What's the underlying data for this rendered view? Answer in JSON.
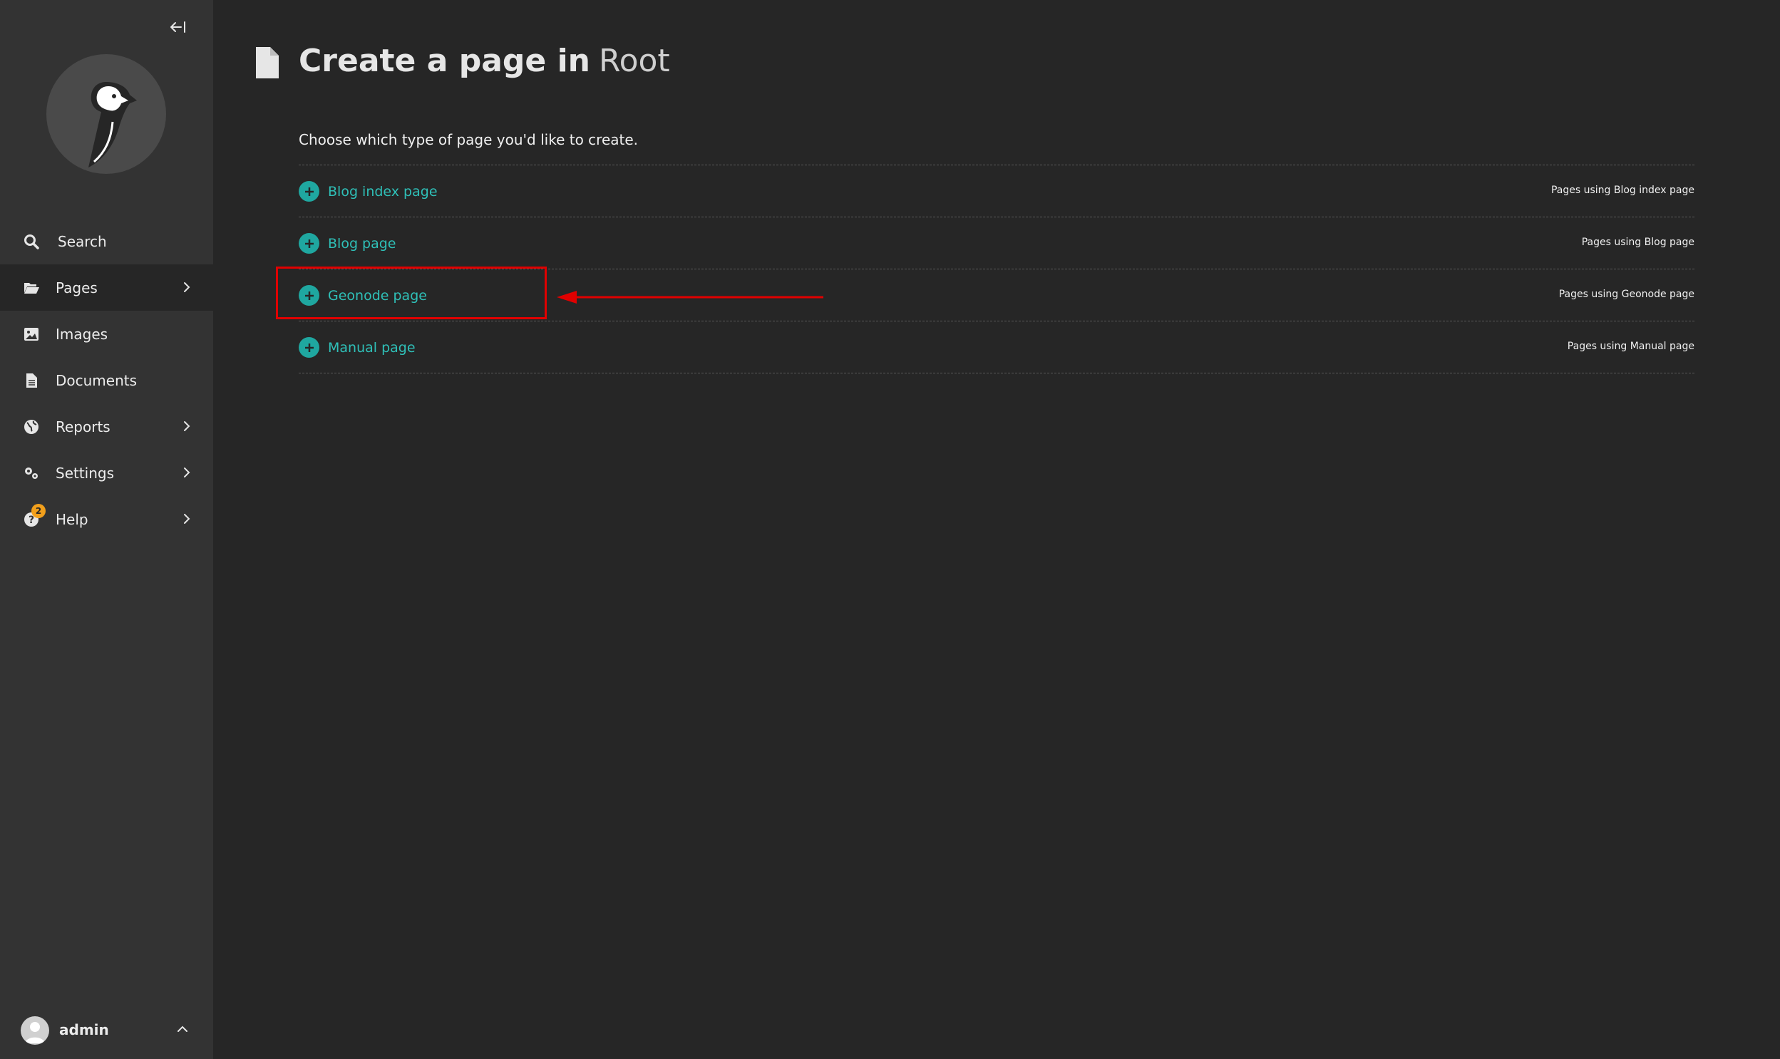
{
  "sidebar": {
    "collapse_label": "←|",
    "items": [
      {
        "label": "Search",
        "icon": "search-icon",
        "has_submenu": false
      },
      {
        "label": "Pages",
        "icon": "folder-open-icon",
        "has_submenu": true
      },
      {
        "label": "Images",
        "icon": "image-icon",
        "has_submenu": false
      },
      {
        "label": "Documents",
        "icon": "document-icon",
        "has_submenu": false
      },
      {
        "label": "Reports",
        "icon": "globe-icon",
        "has_submenu": true
      },
      {
        "label": "Settings",
        "icon": "cogs-icon",
        "has_submenu": true
      },
      {
        "label": "Help",
        "icon": "help-icon",
        "has_submenu": true,
        "badge": "2"
      }
    ],
    "account": {
      "name": "admin"
    }
  },
  "main": {
    "title": "Create a page in",
    "title_parent": "Root",
    "intro": "Choose which type of page you'd like to create.",
    "page_types": [
      {
        "label": "Blog index page",
        "usage": "Pages using Blog index page"
      },
      {
        "label": "Blog page",
        "usage": "Pages using Blog page"
      },
      {
        "label": "Geonode page",
        "usage": "Pages using Geonode page"
      },
      {
        "label": "Manual page",
        "usage": "Pages using Manual page"
      }
    ]
  },
  "colors": {
    "accent": "#2fc0b8",
    "sidebar_bg": "#333333",
    "main_bg": "#262626",
    "annotation": "#e00000",
    "badge": "#f2a01c"
  }
}
